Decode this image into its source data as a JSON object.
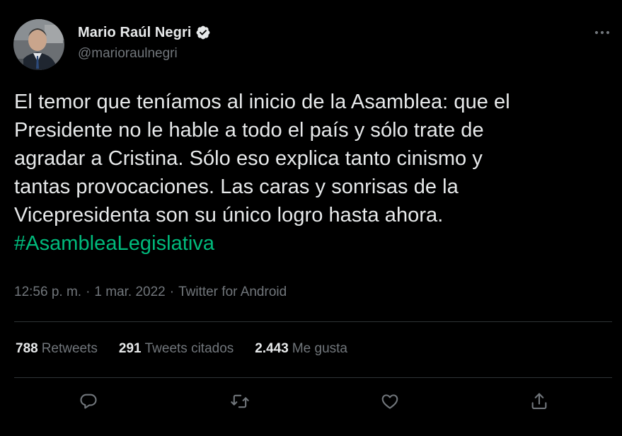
{
  "author": {
    "display_name": "Mario Raúl Negri",
    "handle": "@marioraulnegri",
    "verified": true
  },
  "tweet": {
    "lines": [
      "El temor que teníamos al inicio de la Asamblea: que el",
      "Presidente no le hable a todo el país y sólo trate de",
      "agradar a Cristina. Sólo eso explica tanto cinismo y",
      "tantas provocaciones. Las caras y sonrisas de la",
      "Vicepresidenta son su único logro hasta ahora."
    ],
    "hashtag": "#AsambleaLegislativa"
  },
  "meta": {
    "time": "12:56 p. m.",
    "separator": "·",
    "date": "1 mar. 2022",
    "source": "Twitter for Android"
  },
  "stats": {
    "retweets": {
      "count": "788",
      "label": "Retweets"
    },
    "quotes": {
      "count": "291",
      "label": "Tweets citados"
    },
    "likes": {
      "count": "2.443",
      "label": "Me gusta"
    }
  },
  "icons": {
    "more": "more-horizontal-icon",
    "reply": "reply-icon",
    "retweet": "retweet-icon",
    "like": "heart-icon",
    "share": "share-icon",
    "verified": "verified-badge-icon"
  },
  "colors": {
    "background": "#000000",
    "text": "#e7e9ea",
    "muted": "#71767b",
    "hashtag": "#00ba7c",
    "verified_badge": "#e7e9ea",
    "divider": "#2f3336"
  }
}
